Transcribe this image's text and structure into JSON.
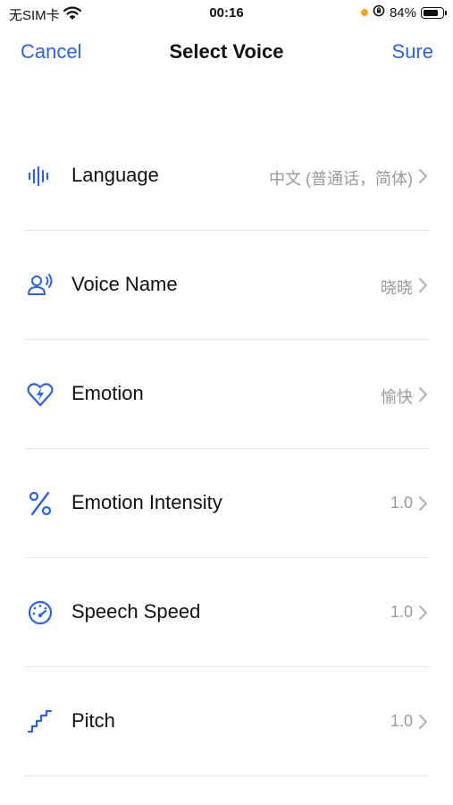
{
  "status_bar": {
    "carrier": "无SIM卡",
    "time": "00:16",
    "battery_percent": "84%",
    "battery_level": 0.84
  },
  "nav": {
    "cancel_label": "Cancel",
    "title": "Select Voice",
    "sure_label": "Sure"
  },
  "settings": [
    {
      "label": "Language",
      "value": "中文 (普通话，简体)",
      "icon": "waveform-icon"
    },
    {
      "label": "Voice Name",
      "value": "晓晓",
      "icon": "speaking-person-icon"
    },
    {
      "label": "Emotion",
      "value": "愉快",
      "icon": "heart-bolt-icon"
    },
    {
      "label": "Emotion Intensity",
      "value": "1.0",
      "icon": "percent-icon"
    },
    {
      "label": "Speech Speed",
      "value": "1.0",
      "icon": "speedometer-icon"
    },
    {
      "label": "Pitch",
      "value": "1.0",
      "icon": "stairs-icon"
    }
  ],
  "colors": {
    "accent": "#2f62e0",
    "value_text": "#9a9a9a",
    "divider": "#e6e6e6",
    "battery_dot": "#f5a623"
  }
}
